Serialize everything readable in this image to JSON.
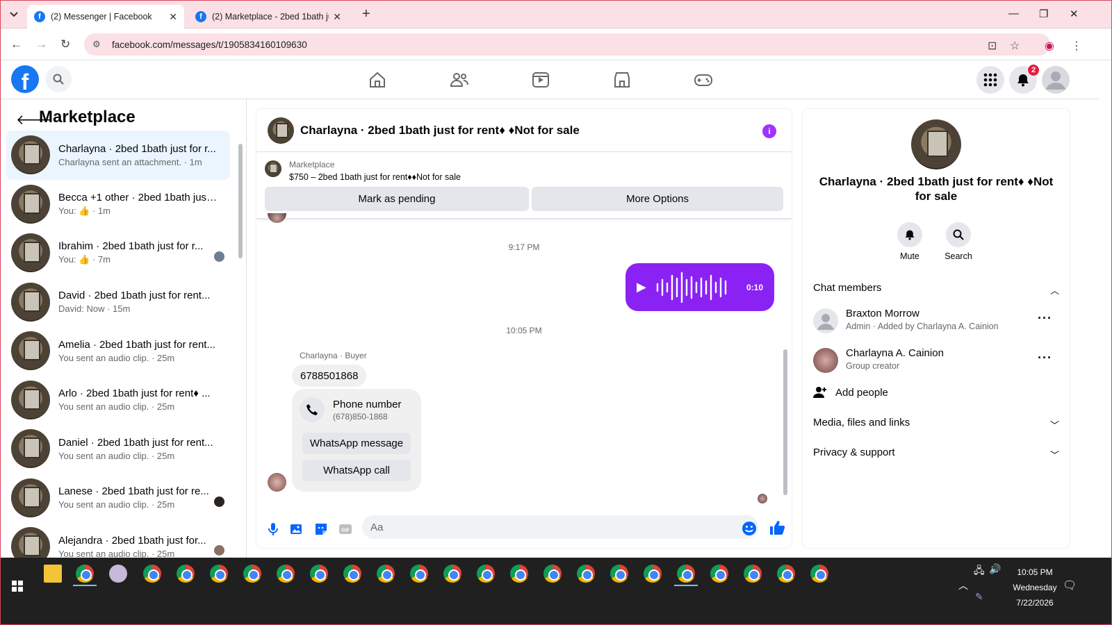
{
  "browser": {
    "tabs": [
      {
        "title": "(2) Messenger | Facebook",
        "active": true
      },
      {
        "title": "(2) Marketplace - 2bed 1bath ju",
        "active": false
      }
    ],
    "url": "facebook.com/messages/t/1905834160109630"
  },
  "header": {
    "notification_count": "2",
    "brand_color": "#1877f2"
  },
  "sidebar": {
    "title": "Marketplace",
    "conversations": [
      {
        "name": "Charlayna · 2bed 1bath just for r...",
        "preview": "Charlayna sent an attachment. · 1m",
        "active": true
      },
      {
        "name": "Becca +1 other · 2bed 1bath just ...",
        "preview": "You: 👍 · 1m"
      },
      {
        "name": "Ibrahim · 2bed 1bath just for r...",
        "preview": "You: 👍 · 7m",
        "seen": true
      },
      {
        "name": "David · 2bed 1bath just for rent...",
        "preview": "David: Now · 15m"
      },
      {
        "name": "Amelia · 2bed 1bath just for rent...",
        "preview": "You sent an audio clip. · 25m"
      },
      {
        "name": "Arlo · 2bed 1bath just for rent♦ ...",
        "preview": "You sent an audio clip. · 25m"
      },
      {
        "name": "Daniel · 2bed 1bath just for rent...",
        "preview": "You sent an audio clip. · 25m"
      },
      {
        "name": "Lanese · 2bed 1bath just for re...",
        "preview": "You sent an audio clip. · 25m",
        "seen": true
      },
      {
        "name": "Alejandra · 2bed 1bath just for...",
        "preview": "You sent an audio clip. · 25m",
        "seen": true
      }
    ]
  },
  "chat": {
    "title": "Charlayna · 2bed 1bath just for rent♦ ♦Not for sale",
    "listing_label": "Marketplace",
    "listing_detail": "$750 – 2bed 1bath just for rent♦♦Not for sale",
    "pending_label": "Mark as pending",
    "options_label": "More Options",
    "time1": "9:17 PM",
    "audio_duration": "0:10",
    "time2": "10:05 PM",
    "sender_label": "Charlayna · Buyer",
    "message": "6788501868",
    "card_title": "Phone number",
    "card_number": "(678)850-1868",
    "whatsapp_message": "WhatsApp message",
    "whatsapp_call": "WhatsApp call",
    "input_placeholder": "Aa",
    "accent_color": "#8a22f4"
  },
  "details": {
    "name": "Charlayna · 2bed 1bath just for rent♦ ♦Not for sale",
    "mute_label": "Mute",
    "search_label": "Search",
    "chat_members_label": "Chat members",
    "members": [
      {
        "name": "Braxton Morrow",
        "role": "Admin · Added by Charlayna A. Cainion"
      },
      {
        "name": "Charlayna A. Cainion",
        "role": "Group creator"
      }
    ],
    "add_people_label": "Add people",
    "media_label": "Media, files and links",
    "privacy_label": "Privacy & support"
  },
  "taskbar": {
    "time": "10:05 PM",
    "day": "Wednesday",
    "date": "7/22/2026"
  }
}
